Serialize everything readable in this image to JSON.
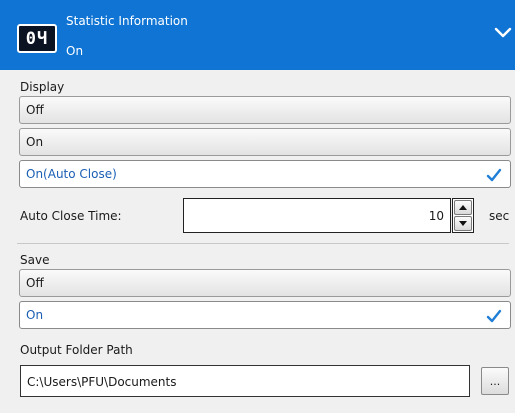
{
  "header": {
    "icon": "counter-display-icon",
    "icon_text": "0Ч",
    "title": "Statistic Information",
    "value": "On",
    "collapse_icon": "chevron-down-icon",
    "bg_color": "#0f74d3"
  },
  "display": {
    "label": "Display",
    "options": [
      {
        "label": "Off",
        "selected": false
      },
      {
        "label": "On",
        "selected": false
      },
      {
        "label": "On(Auto Close)",
        "selected": true
      }
    ]
  },
  "auto_close": {
    "label": "Auto Close Time:",
    "value": "10",
    "unit": "sec"
  },
  "save": {
    "label": "Save",
    "options": [
      {
        "label": "Off",
        "selected": false
      },
      {
        "label": "On",
        "selected": true
      }
    ]
  },
  "output": {
    "label": "Output Folder Path",
    "value": "C:\\Users\\PFU\\Documents",
    "browse_label": "..."
  },
  "colors": {
    "accent": "#0f74d3",
    "selected_text": "#1a5fb4",
    "check": "#1f7fd6"
  }
}
